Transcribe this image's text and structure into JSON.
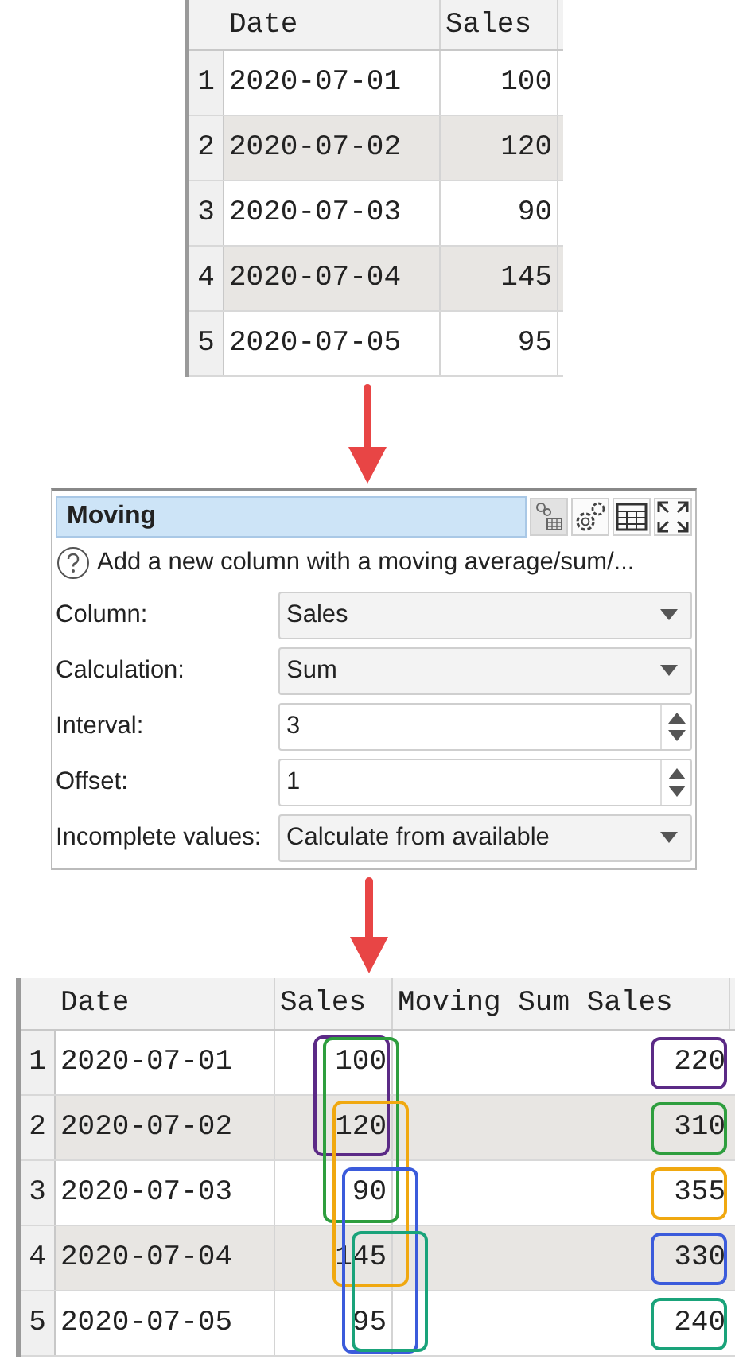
{
  "table_before": {
    "columns": [
      "Date",
      "Sales"
    ],
    "rows": [
      {
        "number": "1",
        "date": "2020-07-01",
        "sales": "100"
      },
      {
        "number": "2",
        "date": "2020-07-02",
        "sales": "120"
      },
      {
        "number": "3",
        "date": "2020-07-03",
        "sales": "90"
      },
      {
        "number": "4",
        "date": "2020-07-04",
        "sales": "145"
      },
      {
        "number": "5",
        "date": "2020-07-05",
        "sales": "95"
      }
    ]
  },
  "panel": {
    "title": "Moving",
    "description": "Add a new column with a moving average/sum/...",
    "fields": [
      {
        "label": "Column:",
        "kind": "dropdown",
        "value": "Sales"
      },
      {
        "label": "Calculation:",
        "kind": "dropdown",
        "value": "Sum"
      },
      {
        "label": "Interval:",
        "kind": "spinner",
        "value": "3"
      },
      {
        "label": "Offset:",
        "kind": "spinner",
        "value": "1"
      },
      {
        "label": "Incomplete values:",
        "kind": "dropdown",
        "value": "Calculate from available"
      }
    ]
  },
  "table_after": {
    "columns": [
      "Date",
      "Sales",
      "Moving Sum Sales"
    ],
    "rows": [
      {
        "number": "1",
        "date": "2020-07-01",
        "sales": "100",
        "moving": "220",
        "color": "#5b2a86"
      },
      {
        "number": "2",
        "date": "2020-07-02",
        "sales": "120",
        "moving": "310",
        "color": "#2e9e3e"
      },
      {
        "number": "3",
        "date": "2020-07-03",
        "sales": "90",
        "moving": "355",
        "color": "#f0a810"
      },
      {
        "number": "4",
        "date": "2020-07-04",
        "sales": "145",
        "moving": "330",
        "color": "#3b5bdb"
      },
      {
        "number": "5",
        "date": "2020-07-05",
        "sales": "95",
        "moving": "240",
        "color": "#1aa37a"
      }
    ]
  }
}
